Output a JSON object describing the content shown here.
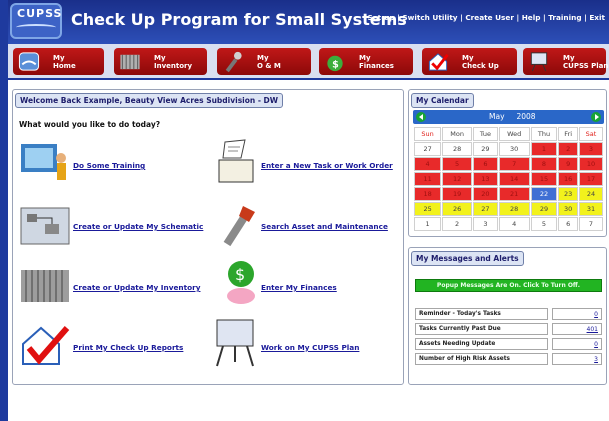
{
  "header": {
    "logo": "CUPSS",
    "title": "Check Up Program for Small Systems",
    "links": [
      "Set-up",
      "Switch Utility",
      "Create User",
      "Help",
      "Training",
      "Exit"
    ],
    "separator": " | "
  },
  "nav": {
    "items": [
      {
        "line1": "My",
        "line2": "Home"
      },
      {
        "line1": "My",
        "line2": "Inventory"
      },
      {
        "line1": "My",
        "line2": "O & M"
      },
      {
        "line1": "My",
        "line2": "Finances"
      },
      {
        "line1": "My",
        "line2": "Check Up"
      },
      {
        "line1": "My",
        "line2": "CUPSS Plan"
      }
    ]
  },
  "main": {
    "welcome": "Welcome Back Example, Beauty View Acres Subdivision - DW",
    "prompt": "What would you like to do today?",
    "tasks": {
      "training": "Do Some Training",
      "new_task": "Enter a New Task or Work Order",
      "schematic": "Create or Update My Schematic",
      "search_asset": "Search Asset and Maintenance",
      "inventory": "Create or Update My Inventory",
      "finances": "Enter My Finances",
      "reports": "Print My Check Up Reports",
      "cupss_plan": "Work on My CUPSS Plan"
    }
  },
  "calendar": {
    "title": "My Calendar",
    "month": "May",
    "year": "2008",
    "days": [
      "Sun",
      "Mon",
      "Tue",
      "Wed",
      "Thu",
      "Fri",
      "Sat"
    ],
    "weeks": [
      [
        "27",
        "28",
        "29",
        "30",
        "1",
        "2",
        "3"
      ],
      [
        "4",
        "5",
        "6",
        "7",
        "8",
        "9",
        "10"
      ],
      [
        "11",
        "12",
        "13",
        "14",
        "15",
        "16",
        "17"
      ],
      [
        "18",
        "19",
        "20",
        "21",
        "22",
        "23",
        "24"
      ],
      [
        "25",
        "26",
        "27",
        "28",
        "29",
        "30",
        "31"
      ],
      [
        "1",
        "2",
        "3",
        "4",
        "5",
        "6",
        "7"
      ]
    ],
    "colors": {
      "past": "#e82a2a",
      "today": "#3f6fd4",
      "future": "#f2f21c",
      "other": "#ffffff",
      "weekend_header": "#e0201a",
      "header_bg": "#2a67c8"
    }
  },
  "messages": {
    "title": "My Messages and Alerts",
    "popup": "Popup Messages Are On. Click To Turn Off.",
    "alerts": [
      {
        "label": "Reminder - Today's Tasks",
        "value": "0"
      },
      {
        "label": "Tasks Currently Past Due",
        "value": "401"
      },
      {
        "label": "Assets Needing Update",
        "value": "0"
      },
      {
        "label": "Number of High Risk Assets",
        "value": "3"
      }
    ]
  }
}
